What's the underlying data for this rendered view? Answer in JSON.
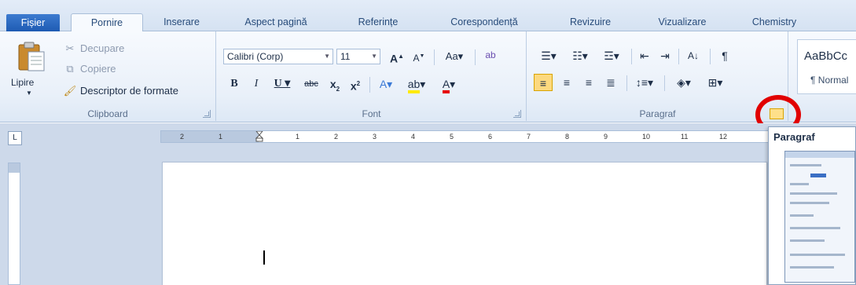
{
  "tabs": [
    {
      "label": "Fișier"
    },
    {
      "label": "Pornire"
    },
    {
      "label": "Inserare"
    },
    {
      "label": "Aspect pagină"
    },
    {
      "label": "Referințe"
    },
    {
      "label": "Corespondență"
    },
    {
      "label": "Revizuire"
    },
    {
      "label": "Vizualizare"
    },
    {
      "label": "Chemistry"
    }
  ],
  "clipboard": {
    "paste_label": "Lipire",
    "cut_label": "Decupare",
    "copy_label": "Copiere",
    "format_painter_label": "Descriptor de formate",
    "group_label": "Clipboard"
  },
  "font": {
    "font_name": "Calibri (Corp)",
    "font_size": "11",
    "group_label": "Font"
  },
  "paragraph": {
    "group_label": "Paragraf"
  },
  "styles": {
    "sample": "AaBbCc",
    "name": "¶ Normal"
  },
  "ruler": {
    "tab_selector": "L",
    "numbers": [
      "2",
      "1",
      "",
      "1",
      "2",
      "3",
      "4",
      "5",
      "6",
      "7",
      "8",
      "9",
      "10",
      "11",
      "12"
    ]
  },
  "tooltip": {
    "title": "Paragraf"
  },
  "colors": {
    "accent": "#1e5bb3",
    "annotation": "#e10000"
  }
}
